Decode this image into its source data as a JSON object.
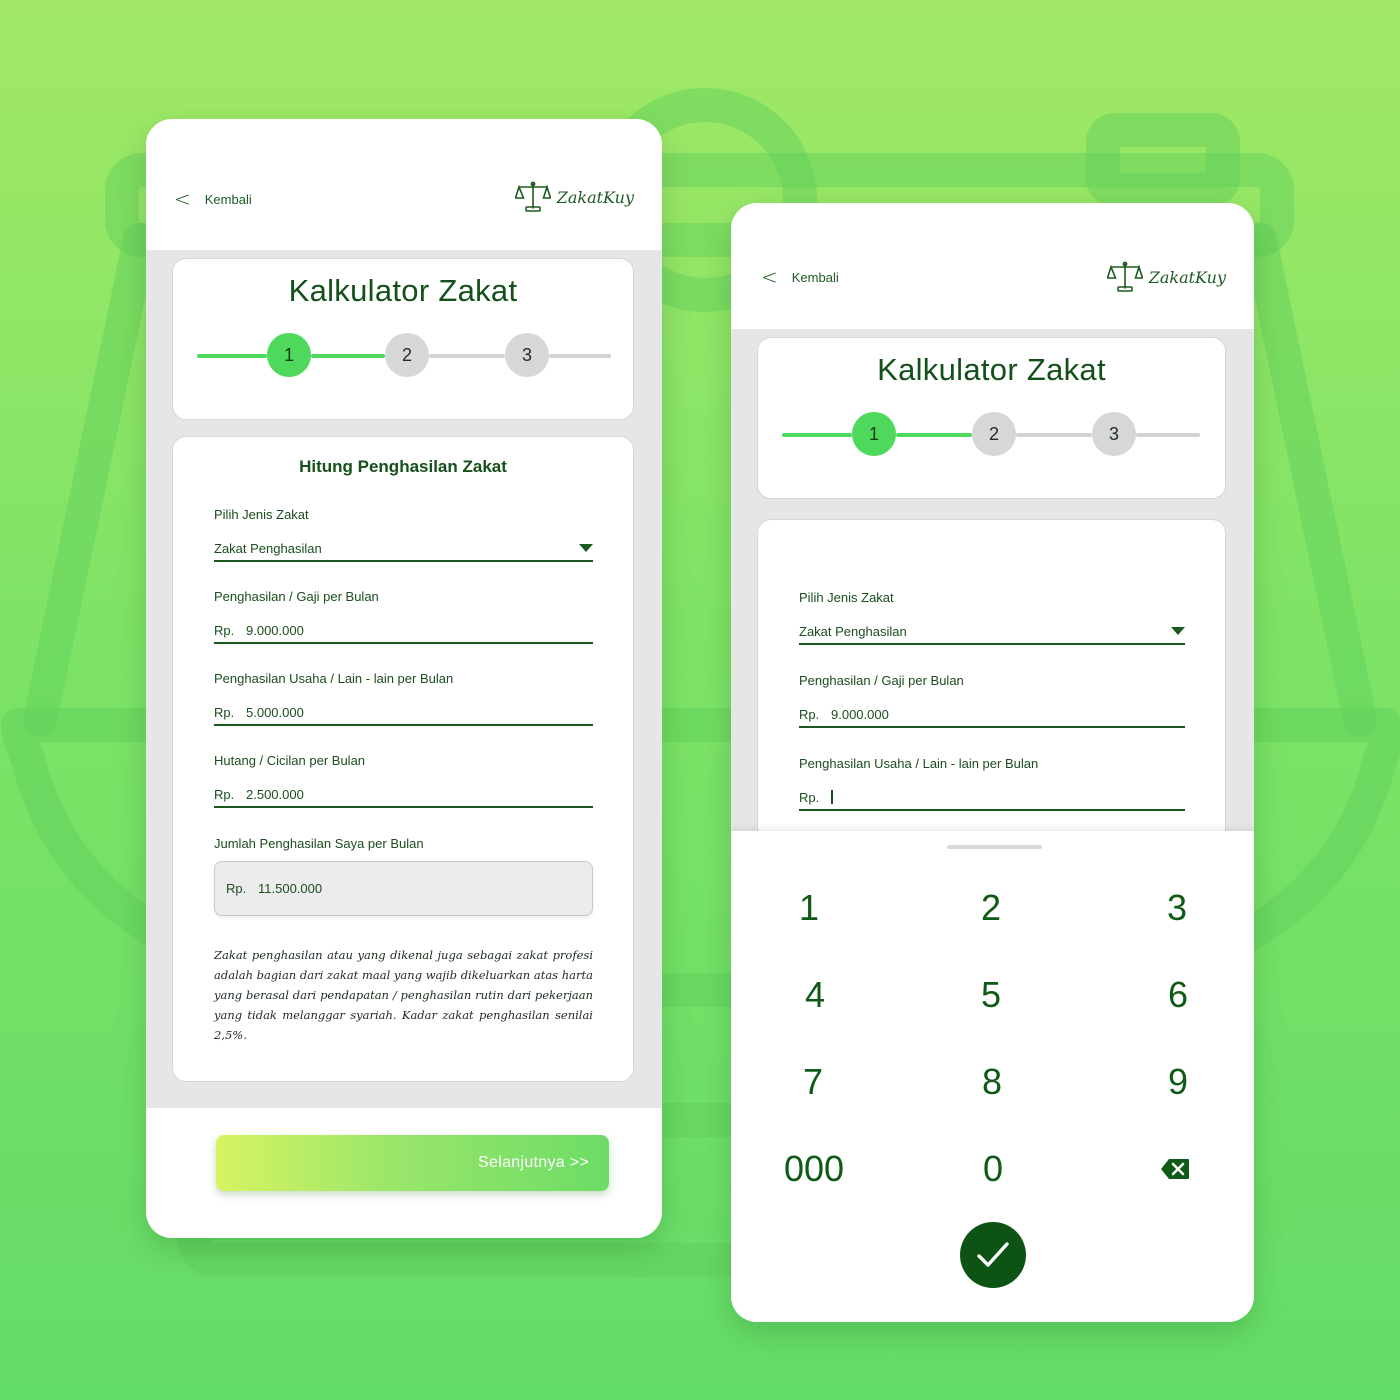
{
  "app": {
    "back_label": "Kembali",
    "brand_name": "ZakatKuy",
    "brand_icon": "scale-icon",
    "colors": {
      "accent": "#4fd95c",
      "brand_dark": "#14501a",
      "inactive": "#d7d7d7"
    }
  },
  "calculator": {
    "title": "Kalkulator Zakat",
    "steps": [
      "1",
      "2",
      "3"
    ],
    "current_step": 1
  },
  "screen1": {
    "form_title": "Hitung Penghasilan Zakat",
    "type_label": "Pilih Jenis Zakat",
    "type_value": "Zakat Penghasilan",
    "salary_label": "Penghasilan  /  Gaji per Bulan",
    "currency": "Rp.",
    "salary_value": "9.000.000",
    "other_label": "Penghasilan Usaha / Lain - lain per Bulan",
    "other_value": "5.000.000",
    "debt_label": "Hutang / Cicilan per Bulan",
    "debt_value": "2.500.000",
    "total_label": "Jumlah Penghasilan Saya per Bulan",
    "total_value": "11.500.000",
    "note": "Zakat penghasilan atau yang dikenal juga sebagai zakat profesi adalah bagian dari zakat maal yang wajib dikeluarkan atas harta yang berasal dari pendapatan / penghasilan rutin dari pekerjaan yang tidak melanggar syariah. Kadar zakat penghasilan senilai 2,5%.",
    "next_label": "Selanjutnya  >>"
  },
  "screen2": {
    "type_label": "Pilih Jenis Zakat",
    "type_value": "Zakat Penghasilan",
    "salary_label": "Penghasilan  /  Gaji per Bulan",
    "currency": "Rp.",
    "salary_value": "9.000.000",
    "other_label": "Penghasilan Usaha / Lain - lain per Bulan",
    "other_value": ""
  },
  "keypad": {
    "keys": [
      "1",
      "2",
      "3",
      "4",
      "5",
      "6",
      "7",
      "8",
      "9",
      "000",
      "0"
    ],
    "backspace_icon": "backspace-icon",
    "confirm_icon": "check-icon"
  }
}
